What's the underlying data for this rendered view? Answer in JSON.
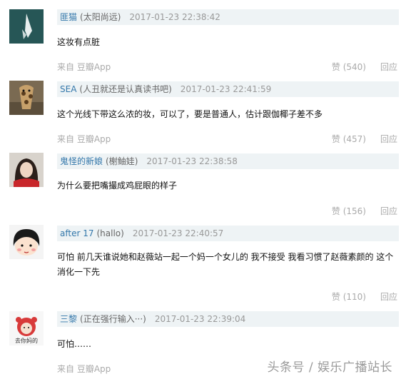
{
  "comments": [
    {
      "username": "匪猫",
      "status": "(太阳尚远)",
      "time": "2017-01-23 22:38:42",
      "text": "这妆有点脏",
      "source": "来自 豆瓣App",
      "likes": "赞 (540)",
      "reply": "回应"
    },
    {
      "username": "SEA",
      "status": "(人丑就还是认真读书吧)",
      "time": "2017-01-23 22:41:59",
      "text": "这个光线下带这么浓的妆，可以了，要是普通人，估计跟伽椰子差不多",
      "source": "来自 豆瓣App",
      "likes": "赞 (457)",
      "reply": "回应"
    },
    {
      "username": "鬼怪的新娘",
      "status": "(榭鲉娃)",
      "time": "2017-01-23 22:38:58",
      "text": "为什么要把嘴撮成鸡屁眼的样子",
      "source": "",
      "likes": "赞 (156)",
      "reply": "回应"
    },
    {
      "username": "after 17",
      "status": "(hallo)",
      "time": "2017-01-23 22:40:57",
      "text": "可怕 前几天谁说她和赵薇站一起一个妈一个女儿的 我不接受 我看习惯了赵薇素颜的 这个消化一下先",
      "source": "",
      "likes": "赞 (110)",
      "reply": "回应"
    },
    {
      "username": "三黎",
      "status": "(正在强行输入···)",
      "time": "2017-01-23 22:39:04",
      "text": "可怕……",
      "source": "来自 豆瓣App",
      "likes": "",
      "reply": ""
    }
  ],
  "avatar5_caption": "去你妈的",
  "watermark": "头条号 / 娱乐广播站长"
}
